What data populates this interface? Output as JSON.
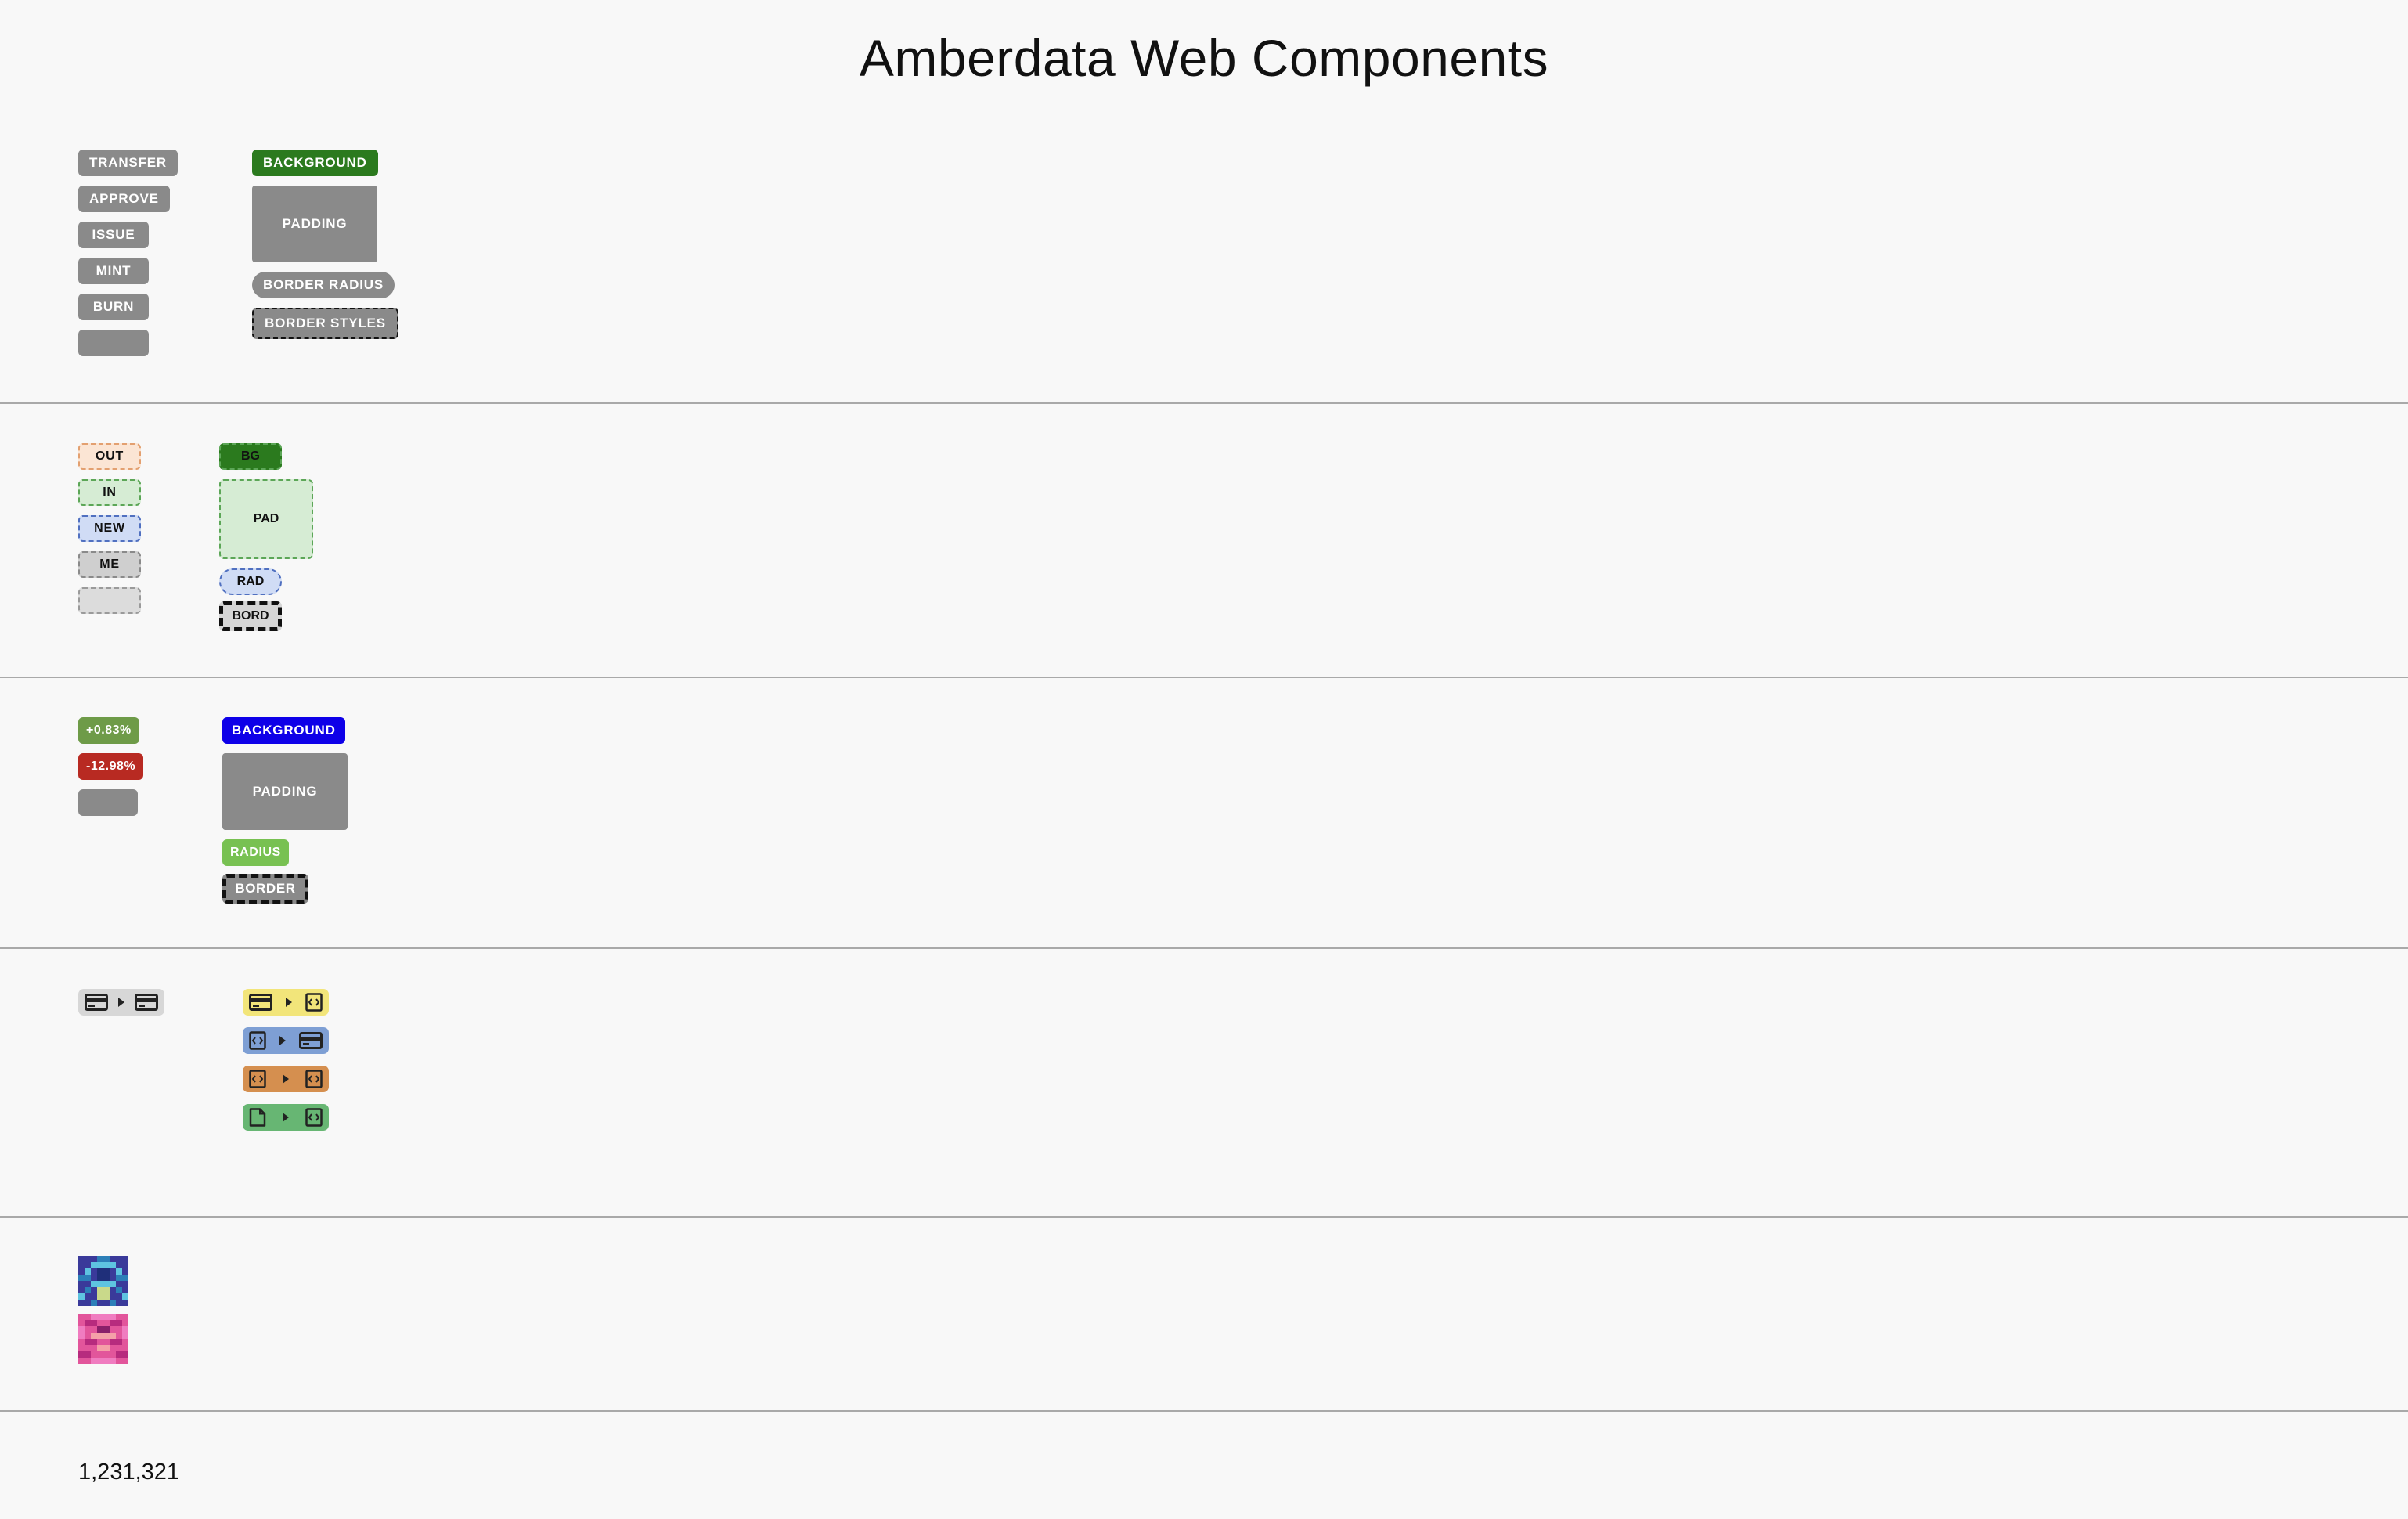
{
  "title": "Amberdata Web Components",
  "section_actions": {
    "transaction_labels": [
      "TRANSFER",
      "APPROVE",
      "ISSUE",
      "MINT",
      "BURN",
      ""
    ],
    "style_demo": {
      "background": "BACKGROUND",
      "padding": "PADDING",
      "border_radius": "BORDER RADIUS",
      "border_styles": "BORDER STYLES"
    }
  },
  "section_direction": {
    "labels": [
      "OUT",
      "IN",
      "NEW",
      "ME",
      ""
    ],
    "style_demo": {
      "background": "BG",
      "padding": "PAD",
      "radius": "RAD",
      "border": "BORD"
    }
  },
  "section_change": {
    "labels": [
      "+0.83%",
      "-12.98%",
      ""
    ],
    "style_demo": {
      "background": "BACKGROUND",
      "padding": "PADDING",
      "radius": "RADIUS",
      "border": "BORDER"
    }
  },
  "section_flow": {
    "plain": {
      "from": "wallet-icon",
      "to": "wallet-icon"
    },
    "colored": [
      {
        "from": "wallet-icon",
        "to": "contract-icon",
        "color": "#f2e57a"
      },
      {
        "from": "contract-icon",
        "to": "wallet-icon",
        "color": "#7e9fd4"
      },
      {
        "from": "contract-icon",
        "to": "contract-icon",
        "color": "#d58f4f"
      },
      {
        "from": "document-icon",
        "to": "contract-icon",
        "color": "#67b673"
      }
    ]
  },
  "section_avatars": {
    "avatars": [
      "blue-blockie-avatar",
      "pink-blockie-avatar"
    ]
  },
  "section_number": {
    "value": "1,231,321"
  },
  "colors": {
    "green": "#2b7a1e",
    "blue": "#0e00e8",
    "up": "#6e9b48",
    "down": "#b82a22",
    "gray": "#8a8a8a"
  }
}
